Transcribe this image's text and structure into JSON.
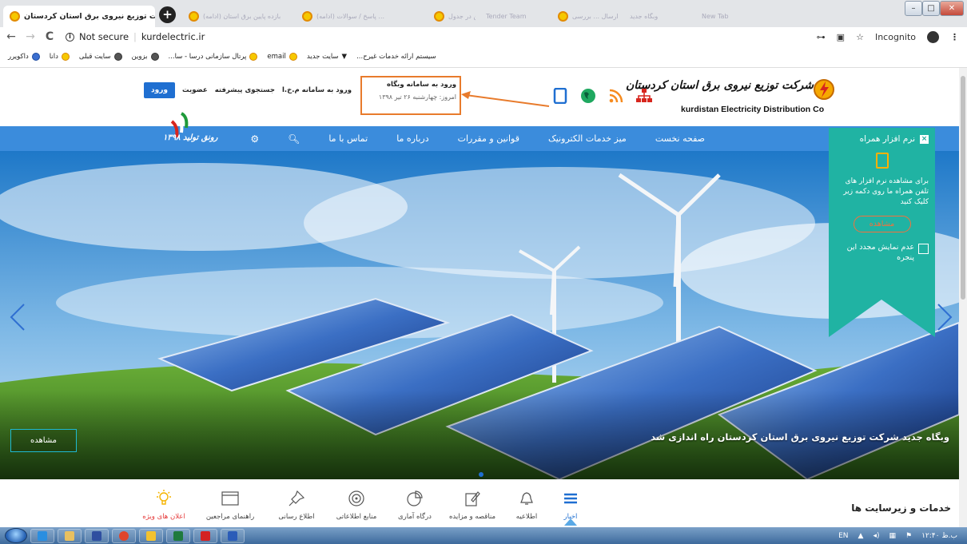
{
  "browser": {
    "active_tab": {
      "title": "شرکت توزیع نیروی برق استان کردستان"
    },
    "background_tabs": [
      "(ادامه) بازده پایین برق استان",
      "(ادامه) پاسخ / سوالات ...",
      "بیشترین متن در جدول",
      "Tender Team",
      "ارسال ... بررسی",
      "وبگاه جدید",
      "New Tab"
    ],
    "new_tab": "+",
    "window_controls": {
      "min": "–",
      "max": "□",
      "close": "✕"
    },
    "nav": {
      "back": "←",
      "forward": "→",
      "reload": "C"
    },
    "security_label": "Not secure",
    "url": "kurdelectric.ir",
    "right": {
      "incognito_label": "Incognito",
      "menu": "⋮"
    }
  },
  "bookmarks": [
    {
      "label": "سیستم ارائه خدمات غیرح...",
      "icon": "folder"
    },
    {
      "label": "سایت جدید",
      "icon": "folder"
    },
    {
      "label": "email",
      "icon": "folder"
    },
    {
      "label": "پرتال سازمانی درسا - سا...",
      "icon": "folder"
    },
    {
      "label": "بزوین",
      "icon": "gray"
    },
    {
      "label": "سایت قبلی",
      "icon": "gray"
    },
    {
      "label": "دانا",
      "icon": "folder"
    },
    {
      "label": "داکویرر",
      "icon": "blue"
    }
  ],
  "header": {
    "logo_fa": "شرکت توزیع نیروی برق استان کردستان",
    "logo_en": "kurdistan Electricity Distribution Co",
    "login_box": {
      "line1_a": "ورود به سامانه وبگاه",
      "line1_b": "ورود به سامانه م.خ.ا",
      "date": "امروز: چهارشنبه ۲۶ تیر ۱۳۹۸"
    },
    "links": {
      "advanced_search": "جستجوی پیشرفته",
      "membership": "عضویت",
      "login_button": "ورود"
    },
    "annotation_color": "#e87b2c"
  },
  "navbar": {
    "items": [
      "صفحه نخست",
      "میز خدمات الکترونیک",
      "قوانین و مقررات",
      "درباره ما",
      "تماس با ما"
    ],
    "brand_text": "رونق تولید ۱۳۹۸",
    "color": "#3b8cdc"
  },
  "hero": {
    "caption": "وبگاه جدید شرکت توزیع نیروی برق استان کردستان راه اندازی شد",
    "button": "مشاهده"
  },
  "mobile_panel": {
    "title": "نرم افزار همراه",
    "close": "×",
    "text": "برای مشاهده نرم افزار های تلفن همراه ما روی دکمه زیر کلیک کنید",
    "button": "مشاهده",
    "checkbox": "عدم نمایش مجدد این پنجره",
    "color": "#20b3a3"
  },
  "services": {
    "title": "خدمات و زیرسایت ها",
    "items": [
      {
        "label": "اخبار",
        "icon": "news-icon"
      },
      {
        "label": "اطلاعیه",
        "icon": "bell-icon"
      },
      {
        "label": "مناقصه و مزایده",
        "icon": "edit-icon"
      },
      {
        "label": "درگاه آماری",
        "icon": "pie-chart-icon"
      },
      {
        "label": "منابع اطلاعاتی",
        "icon": "disc-icon"
      },
      {
        "label": "اطلاع رسانی",
        "icon": "pin-icon"
      },
      {
        "label": "راهنمای مراجعین",
        "icon": "window-icon"
      },
      {
        "label": "اعلان های ویژه",
        "icon": "bulb-icon"
      }
    ]
  },
  "taskbar": {
    "lang": "EN",
    "time": "۱۲:۴۰ ب.ظ"
  }
}
